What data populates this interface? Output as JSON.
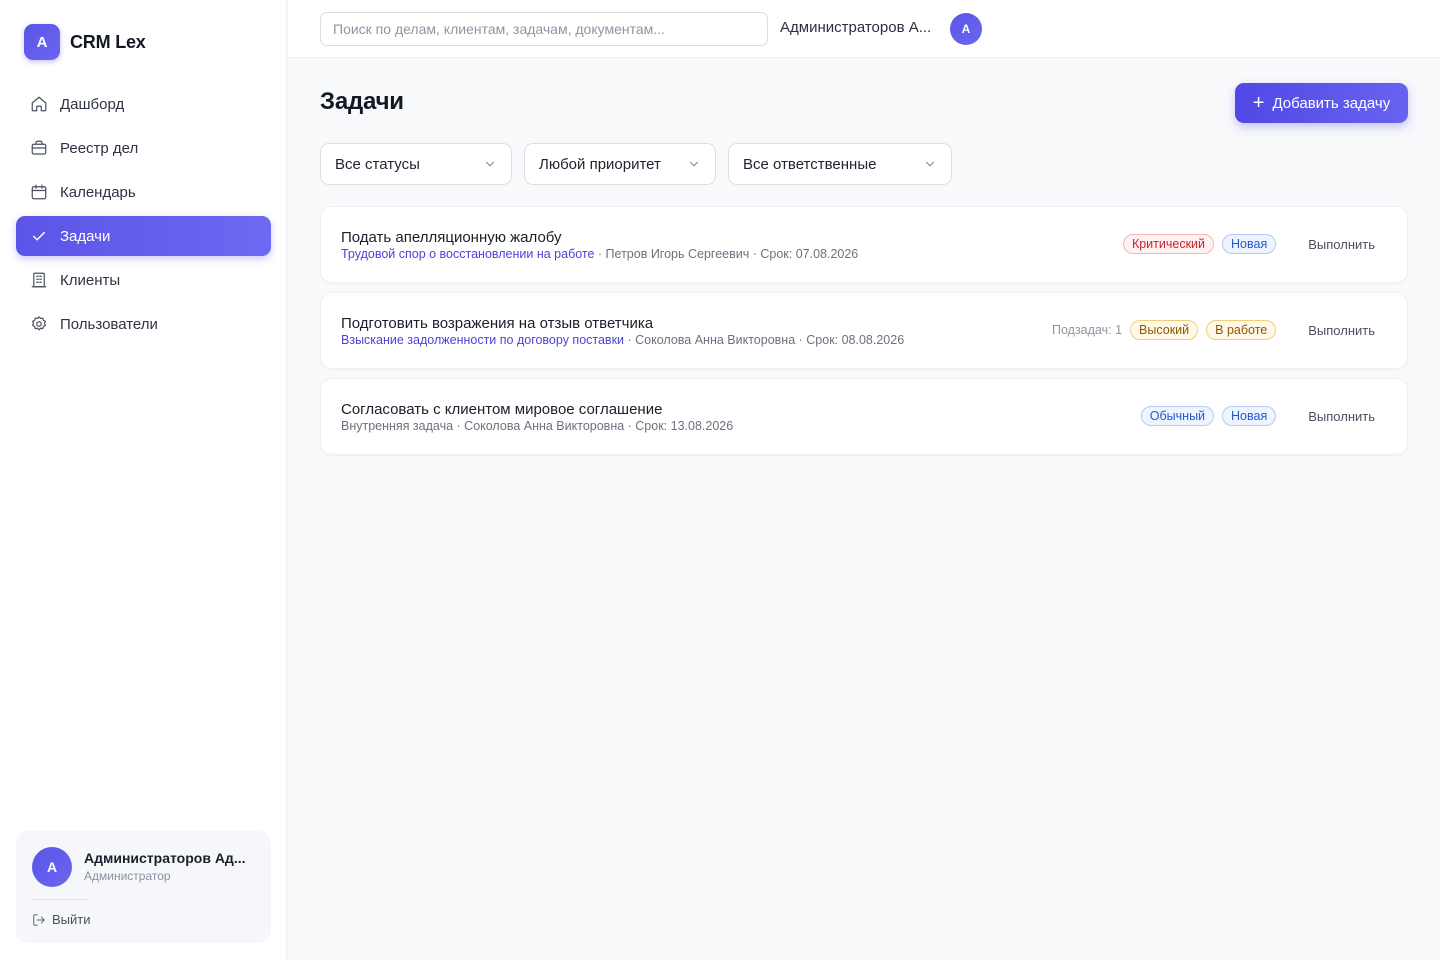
{
  "brand": {
    "logo_letter": "А",
    "name": "CRM Lex"
  },
  "sidebar": {
    "items": [
      {
        "label": "Дашборд",
        "icon": "home-icon",
        "active": false
      },
      {
        "label": "Реестр дел",
        "icon": "briefcase-icon",
        "active": false
      },
      {
        "label": "Календарь",
        "icon": "calendar-icon",
        "active": false
      },
      {
        "label": "Задачи",
        "icon": "check-icon",
        "active": true
      },
      {
        "label": "Клиенты",
        "icon": "building-icon",
        "active": false
      },
      {
        "label": "Пользователи",
        "icon": "users-gear-icon",
        "active": false
      }
    ],
    "user": {
      "avatar_letter": "А",
      "name": "Администраторов Ад...",
      "role": "Администратор",
      "logout_label": "Выйти"
    }
  },
  "header": {
    "search_placeholder": "Поиск по делам, клиентам, задачам, документам...",
    "user_name": "Администраторов А...",
    "avatar_letter": "А"
  },
  "main": {
    "title": "Задачи",
    "add_button_label": "Добавить задачу",
    "filters": {
      "status": "Все статусы",
      "priority": "Любой приоритет",
      "assignee": "Все ответственные"
    },
    "tasks": [
      {
        "title": "Подать апелляционную жалобу",
        "case": "Трудовой спор о восстановлении на работе",
        "rest": " · Петров Игорь Сергеевич · Срок: 07.08.2026",
        "subtasks": "",
        "priority": "Критический",
        "status": "Новая",
        "action": "Выполнить"
      },
      {
        "title": "Подготовить возражения на отзыв ответчика",
        "case": "Взыскание задолженности по договору поставки",
        "rest": " · Соколова Анна Викторовна · Срок: 08.08.2026",
        "subtasks": "Подзадач: 1",
        "priority": "Высокий",
        "status": "В работе",
        "action": "Выполнить"
      },
      {
        "title": "Согласовать с клиентом мировое соглашение",
        "case": "",
        "rest": "Внутренняя задача · Соколова Анна Викторовна · Срок: 13.08.2026",
        "subtasks": "",
        "priority": "Обычный",
        "status": "Новая",
        "action": "Выполнить"
      }
    ]
  },
  "colors": {
    "accent": "#5b54e8",
    "critical": "#c8232a",
    "high": "#8a5a00",
    "new": "#2459c5"
  }
}
